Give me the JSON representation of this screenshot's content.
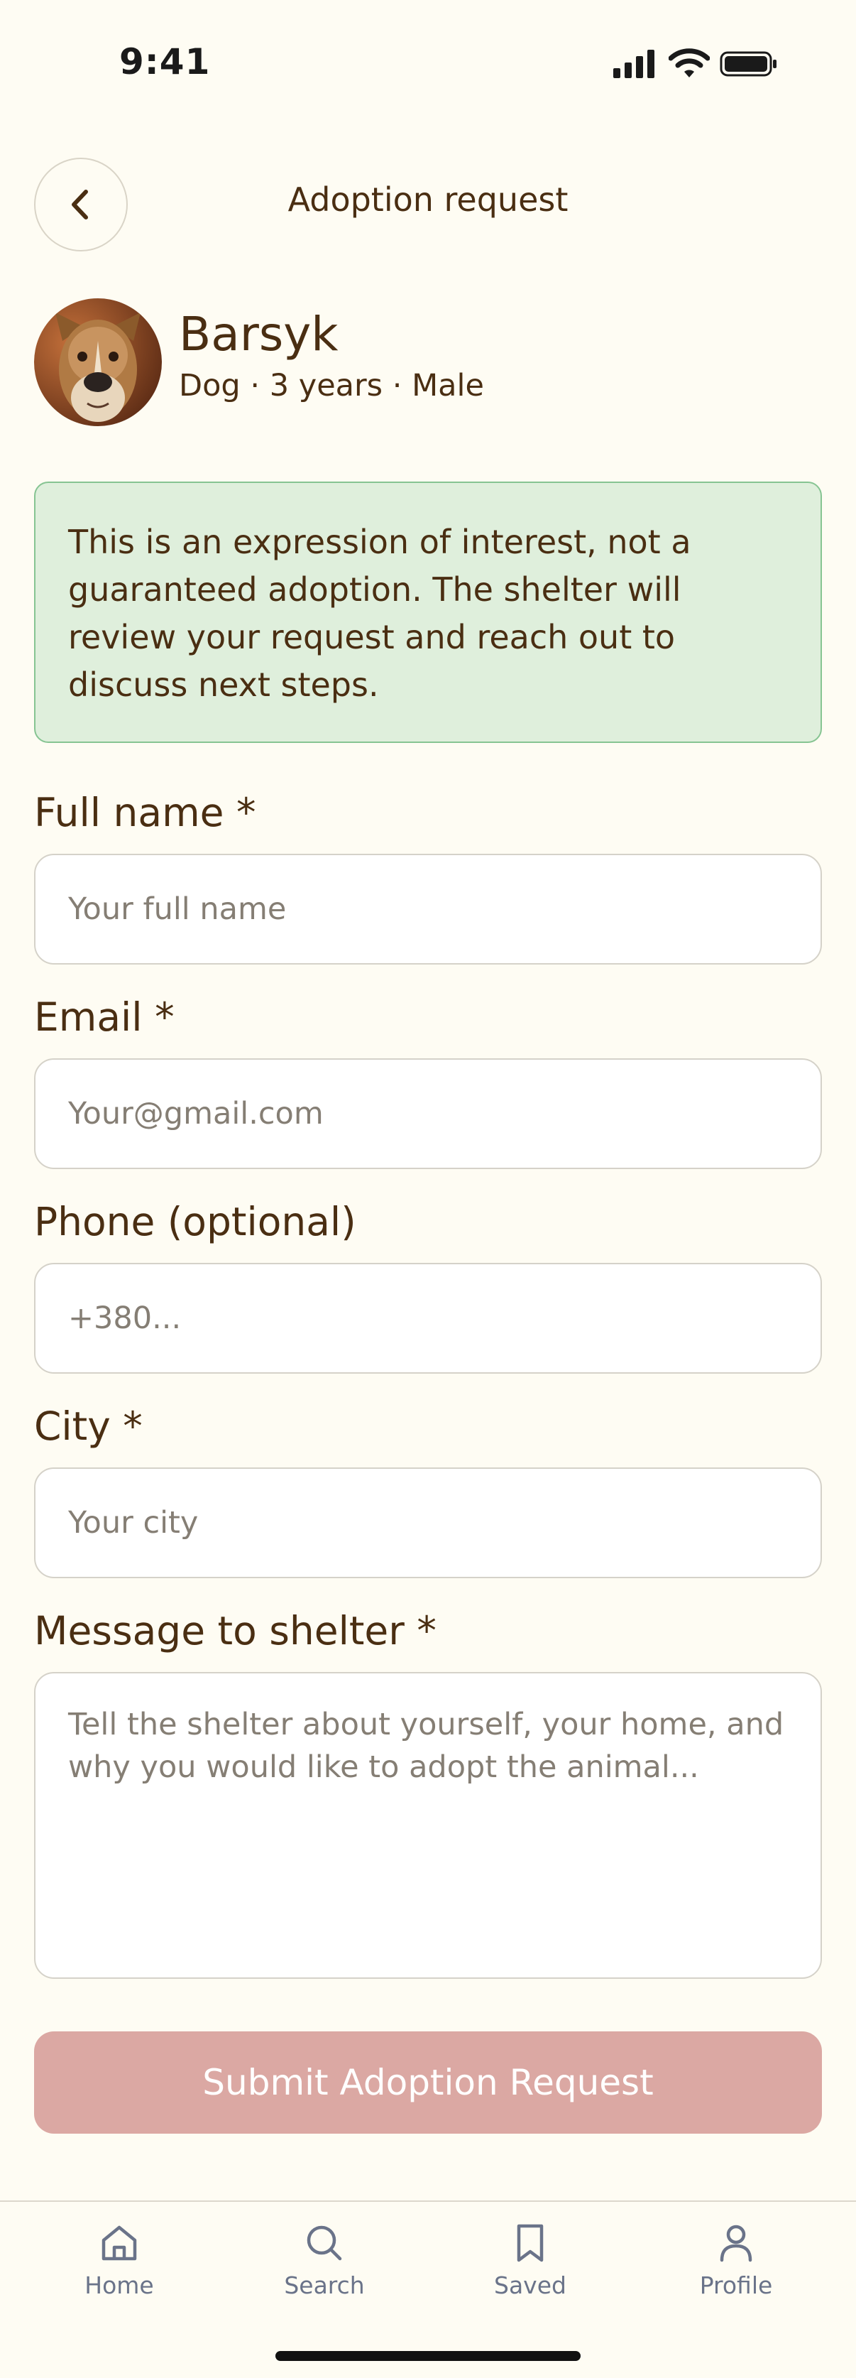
{
  "status": {
    "time": "9:41"
  },
  "header": {
    "title": "Adoption request",
    "back_icon": "chevron-left-icon"
  },
  "pet": {
    "name": "Barsyk",
    "meta": "Dog · 3 years · Male"
  },
  "notice": "This is an expression of interest, not a guaranteed adoption. The shelter will review your request and reach out to discuss next steps.",
  "form": {
    "full_name": {
      "label": "Full name *",
      "placeholder": "Your full name",
      "value": ""
    },
    "email": {
      "label": "Email *",
      "placeholder": "Your@gmail.com",
      "value": ""
    },
    "phone": {
      "label": "Phone (optional)",
      "placeholder": "+380...",
      "value": ""
    },
    "city": {
      "label": "City *",
      "placeholder": "Your city",
      "value": ""
    },
    "message": {
      "label": "Message to shelter *",
      "placeholder": "Tell the shelter about yourself, your home, and why you would like to adopt the animal...",
      "value": ""
    }
  },
  "submit_label": "Submit Adoption Request",
  "tabs": [
    {
      "label": "Home",
      "icon": "home-icon"
    },
    {
      "label": "Search",
      "icon": "search-icon"
    },
    {
      "label": "Saved",
      "icon": "bookmark-icon"
    },
    {
      "label": "Profile",
      "icon": "profile-icon"
    }
  ],
  "colors": {
    "background": "#FEFCF3",
    "text": "#4A2E12",
    "notice_bg": "#DFEFDC",
    "notice_border": "#86C492",
    "submit_disabled": "#DBA8A3",
    "tab_inactive": "#6A7389"
  }
}
